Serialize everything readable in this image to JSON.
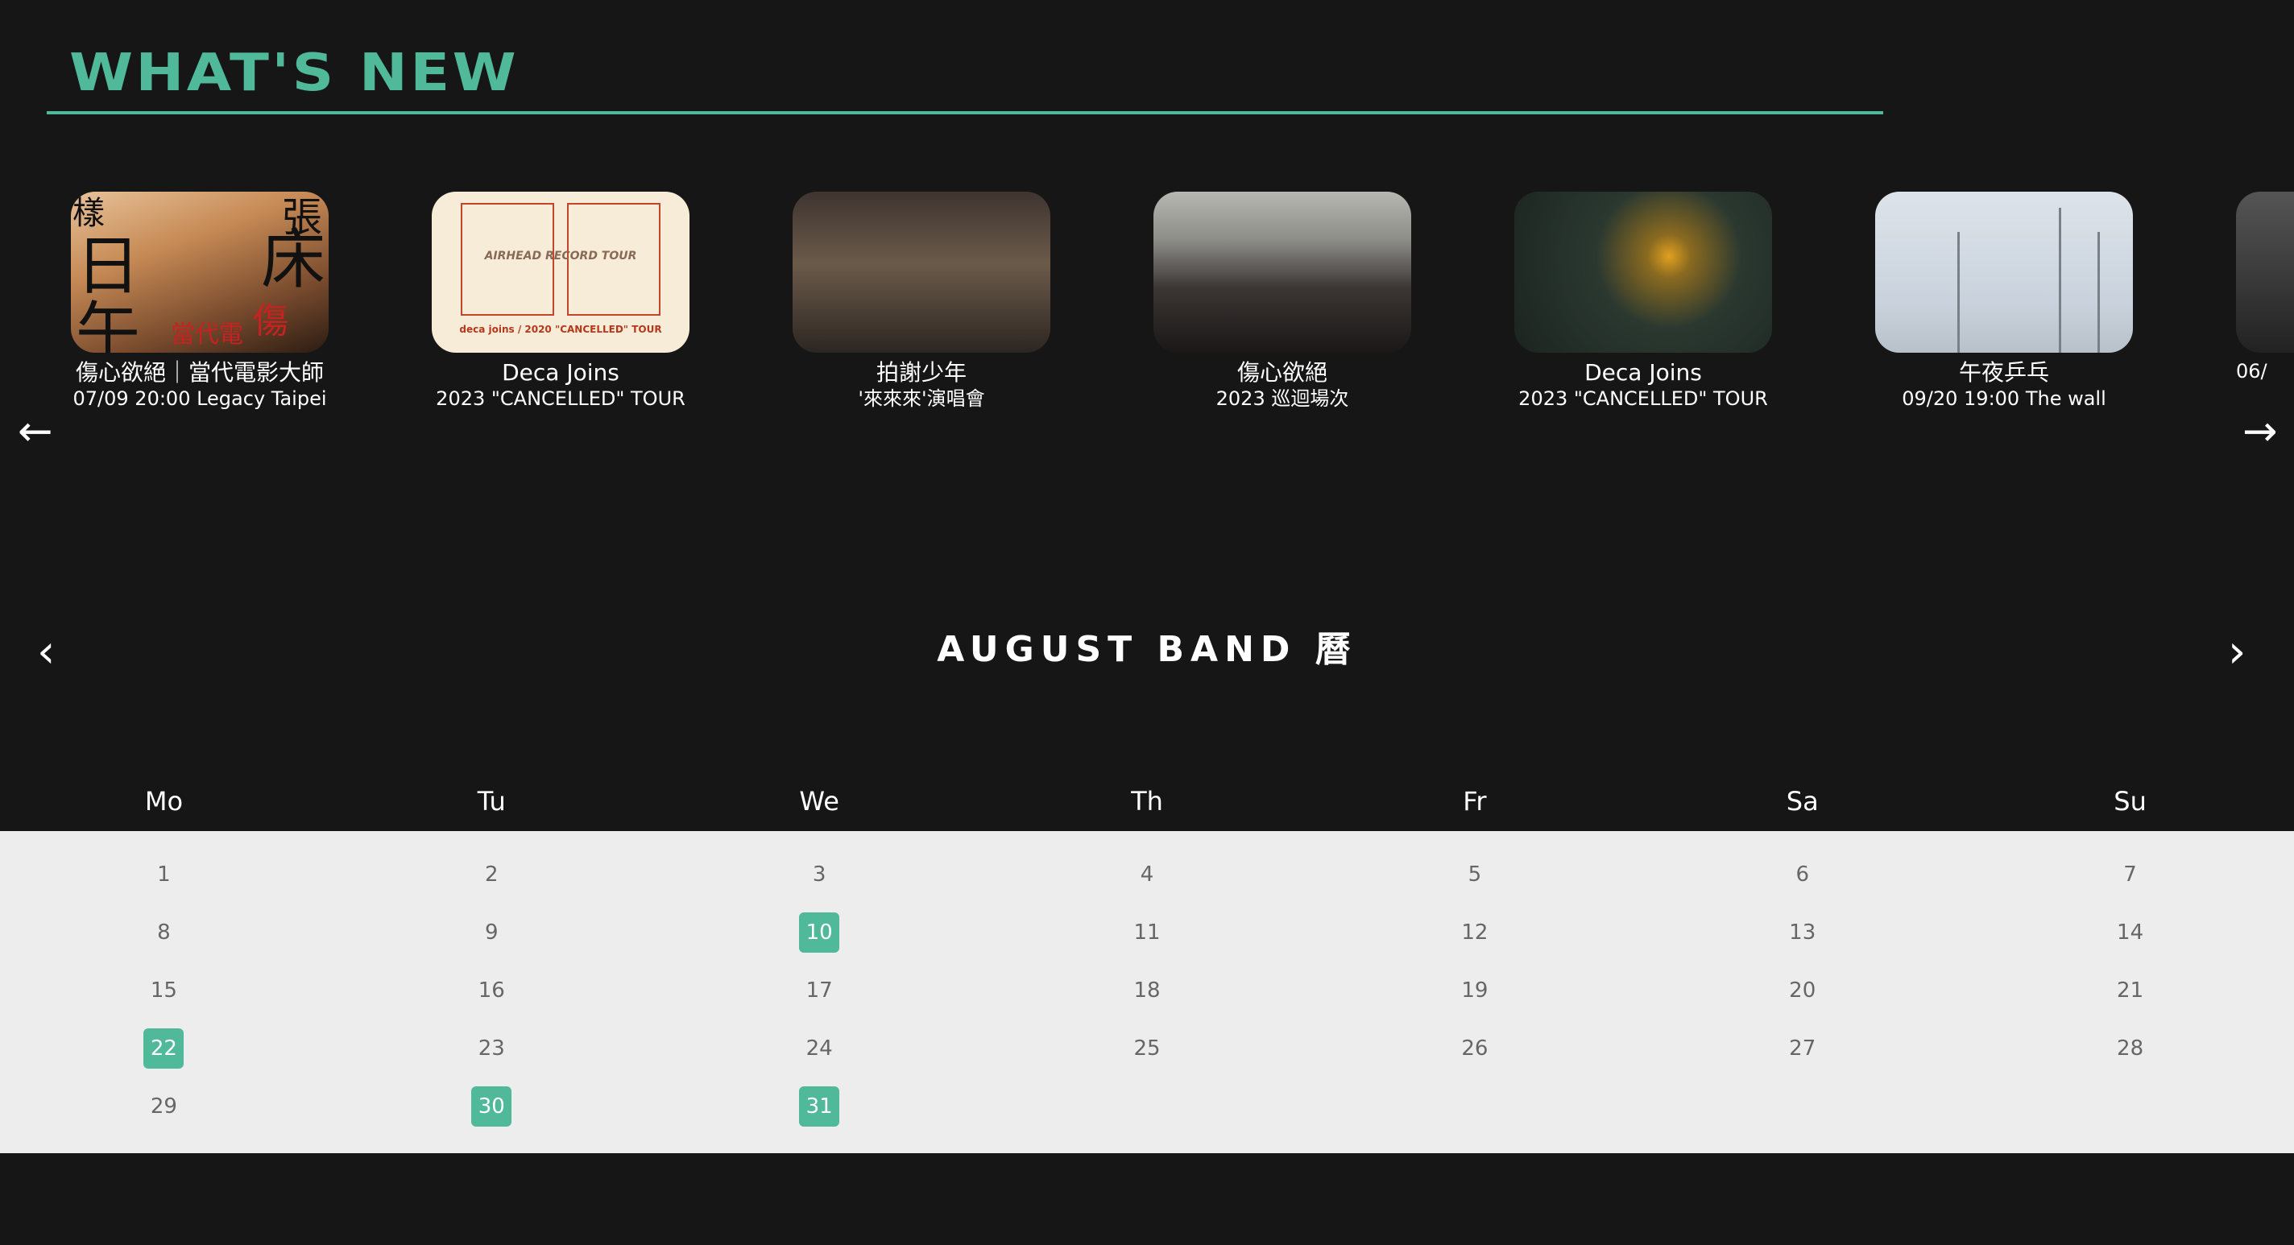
{
  "header": {
    "title": "WHAT'S NEW"
  },
  "carousel": {
    "prev_icon": "arrow-left-icon",
    "next_icon": "arrow-right-icon",
    "cards": [
      {
        "title": "傷心欲絕｜當代電影大師",
        "subtitle": "07/09 20:00 Legacy Taipei"
      },
      {
        "title": "Deca Joins",
        "subtitle": "2023 \"CANCELLED\" TOUR"
      },
      {
        "title": "拍謝少年",
        "subtitle": "'來來來'演唱會"
      },
      {
        "title": "傷心欲絕",
        "subtitle": "2023 巡迴場次"
      },
      {
        "title": "Deca Joins",
        "subtitle": "2023 \"CANCELLED\" TOUR"
      },
      {
        "title": "午夜乒乓",
        "subtitle": "09/20 19:00 The wall"
      },
      {
        "title": "",
        "subtitle": "06/"
      }
    ],
    "poster_text": {
      "card1_glyphs": [
        "樣",
        "張",
        "日",
        "床",
        "午",
        "傷",
        "當代電"
      ],
      "card2_lines": [
        "AIRHEAD RECORD TOUR",
        "deca joins / 2020 \"CANCELLED\" TOUR"
      ]
    }
  },
  "calendar": {
    "title": "AUGUST BAND 曆",
    "prev_label": "‹",
    "next_label": "›",
    "weekdays": [
      "Mo",
      "Tu",
      "We",
      "Th",
      "Fr",
      "Sa",
      "Su"
    ],
    "weeks": [
      [
        "1",
        "2",
        "3",
        "4",
        "5",
        "6",
        "7"
      ],
      [
        "8",
        "9",
        "10",
        "11",
        "12",
        "13",
        "14"
      ],
      [
        "15",
        "16",
        "17",
        "18",
        "19",
        "20",
        "21"
      ],
      [
        "22",
        "23",
        "24",
        "25",
        "26",
        "27",
        "28"
      ],
      [
        "29",
        "30",
        "31",
        "",
        "",
        "",
        ""
      ]
    ],
    "event_days": [
      "10",
      "22",
      "30",
      "31"
    ],
    "event_color": "#4fb99a"
  },
  "colors": {
    "accent": "#4fb99a",
    "background": "#161616",
    "calendar_bg": "#ededed"
  }
}
